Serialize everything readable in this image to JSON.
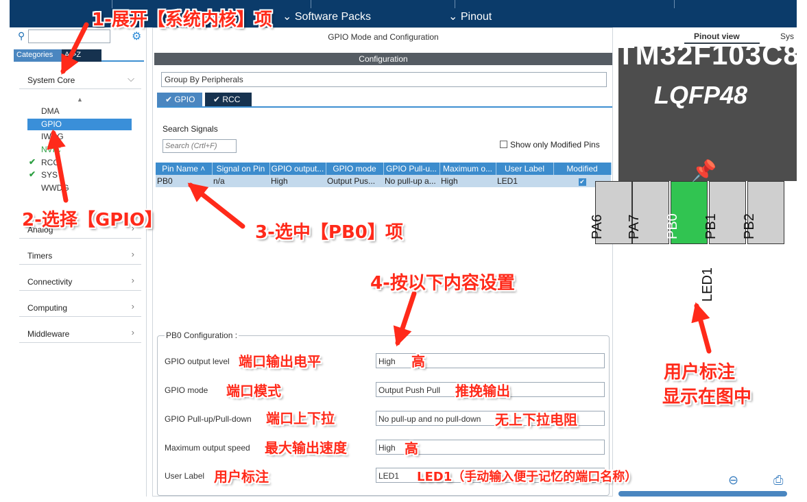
{
  "topbar": {
    "software_packs": "Software Packs",
    "pinout": "Pinout"
  },
  "left": {
    "tab_categories": "Categories",
    "tab_az": "A->Z",
    "system_core": "System Core",
    "sub_items": [
      "DMA",
      "GPIO",
      "IWDG",
      "NVIC",
      "RCC",
      "SYS",
      "WWDG"
    ],
    "analog": "Analog",
    "timers": "Timers",
    "connectivity": "Connectivity",
    "computing": "Computing",
    "middleware": "Middleware"
  },
  "center": {
    "title": "GPIO Mode and Configuration",
    "configuration": "Configuration",
    "group_by": "Group By Peripherals",
    "tab_gpio": "GPIO",
    "tab_rcc": "RCC",
    "search_signals": "Search Signals",
    "search_placeholder": "Search (Crtl+F)",
    "show_modified": "Show only Modified Pins",
    "table": {
      "headers": [
        "Pin Name",
        "Signal on Pin",
        "GPIO output...",
        "GPIO mode",
        "GPIO Pull-u...",
        "Maximum o...",
        "User Label",
        "Modified"
      ],
      "rows": [
        {
          "pin": "PB0",
          "signal": "n/a",
          "output": "High",
          "mode": "Output Pus...",
          "pull": "No pull-up a...",
          "max": "High",
          "label": "LED1",
          "modified": true
        }
      ]
    },
    "pb0_config": {
      "legend": "PB0 Configuration :",
      "rows": [
        {
          "label": "GPIO output level",
          "value": "High"
        },
        {
          "label": "GPIO mode",
          "value": "Output Push Pull"
        },
        {
          "label": "GPIO Pull-up/Pull-down",
          "value": "No pull-up and no pull-down"
        },
        {
          "label": "Maximum output speed",
          "value": "High"
        },
        {
          "label": "User Label",
          "value": "LED1"
        }
      ]
    }
  },
  "right": {
    "pinout_view": "Pinout view",
    "sys_view": "Sys",
    "chip_name": "TM32F103C8",
    "package": "LQFP48",
    "pins": [
      "PA6",
      "PA7",
      "PB0",
      "PB1",
      "PB2"
    ],
    "pin_label": "LED1"
  },
  "annotations": {
    "step1": "1-展开【系统内核】项",
    "step2": "2-选择【GPIO】",
    "step3": "3-选中【PB0】项",
    "step4": "4-按以下内容设置",
    "level": "端口输出电平",
    "level_val": "高",
    "mode": "端口模式",
    "mode_val": "推挽输出",
    "pull": "端口上下拉",
    "pull_val": "无上下拉电阻",
    "speed": "最大输出速度",
    "speed_val": "高",
    "user_label": "用户标注",
    "user_label_val": "LED1（手动输入便于记忆的端口名称）",
    "user_label_shown_1": "用户标注",
    "user_label_shown_2": "显示在图中"
  },
  "colors": {
    "accent": "#3c8ccd",
    "annotation": "#ff2a1a",
    "pin_active": "#31c451"
  }
}
